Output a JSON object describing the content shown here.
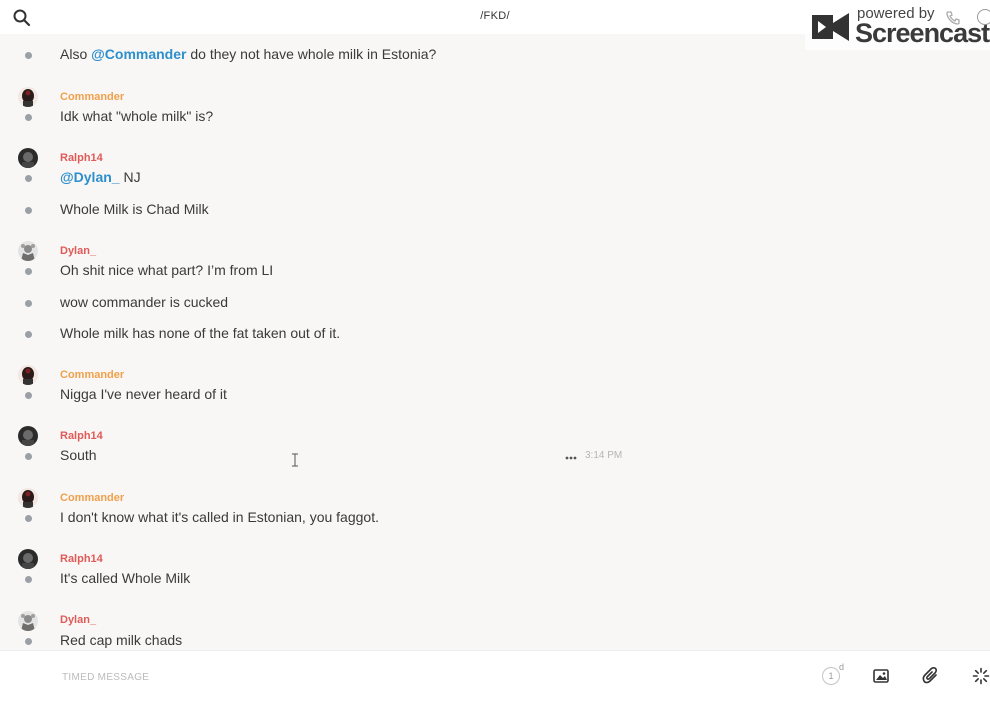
{
  "header": {
    "channel_title": "/FKD/"
  },
  "watermark": {
    "powered_by": "powered by",
    "brand": "Screencastify"
  },
  "colors": {
    "mention": "#2d8fcc",
    "commander_name": "#f0a04b",
    "other_name": "#e05a57"
  },
  "messages": {
    "m0": {
      "text_prefix": "Also ",
      "mention": "@Commander",
      "text_suffix": " do they not have whole milk in Estonia?"
    },
    "m1": {
      "author": "Commander",
      "text": "Idk what \"whole milk\" is?"
    },
    "m2": {
      "author": "Ralph14",
      "mention": "@Dylan_",
      "text_suffix": " NJ"
    },
    "m3": {
      "text": "Whole Milk is Chad Milk"
    },
    "m4": {
      "author": "Dylan_",
      "text": "Oh shit nice what part? I’m from LI"
    },
    "m5": {
      "text": "wow commander is cucked"
    },
    "m6": {
      "text": "Whole milk has none of the fat taken out of it."
    },
    "m7": {
      "author": "Commander",
      "text": "Nigga I've never heard of it"
    },
    "m8": {
      "author": "Ralph14",
      "text": "South",
      "time": "3:14 PM"
    },
    "m9": {
      "author": "Commander",
      "text": "I don't know what it's called in Estonian, you faggot."
    },
    "m10": {
      "author": "Ralph14",
      "text": "It's called Whole Milk"
    },
    "m11": {
      "author": "Dylan_",
      "text": "Red cap milk chads"
    }
  },
  "composer": {
    "placeholder": "TIMED MESSAGE",
    "timer_value": "1",
    "timer_unit": "d"
  },
  "icons": {
    "search": "search-icon",
    "more": "more-options-icon",
    "image": "image-icon",
    "attach": "paperclip-icon",
    "loader": "spinner-icon"
  }
}
